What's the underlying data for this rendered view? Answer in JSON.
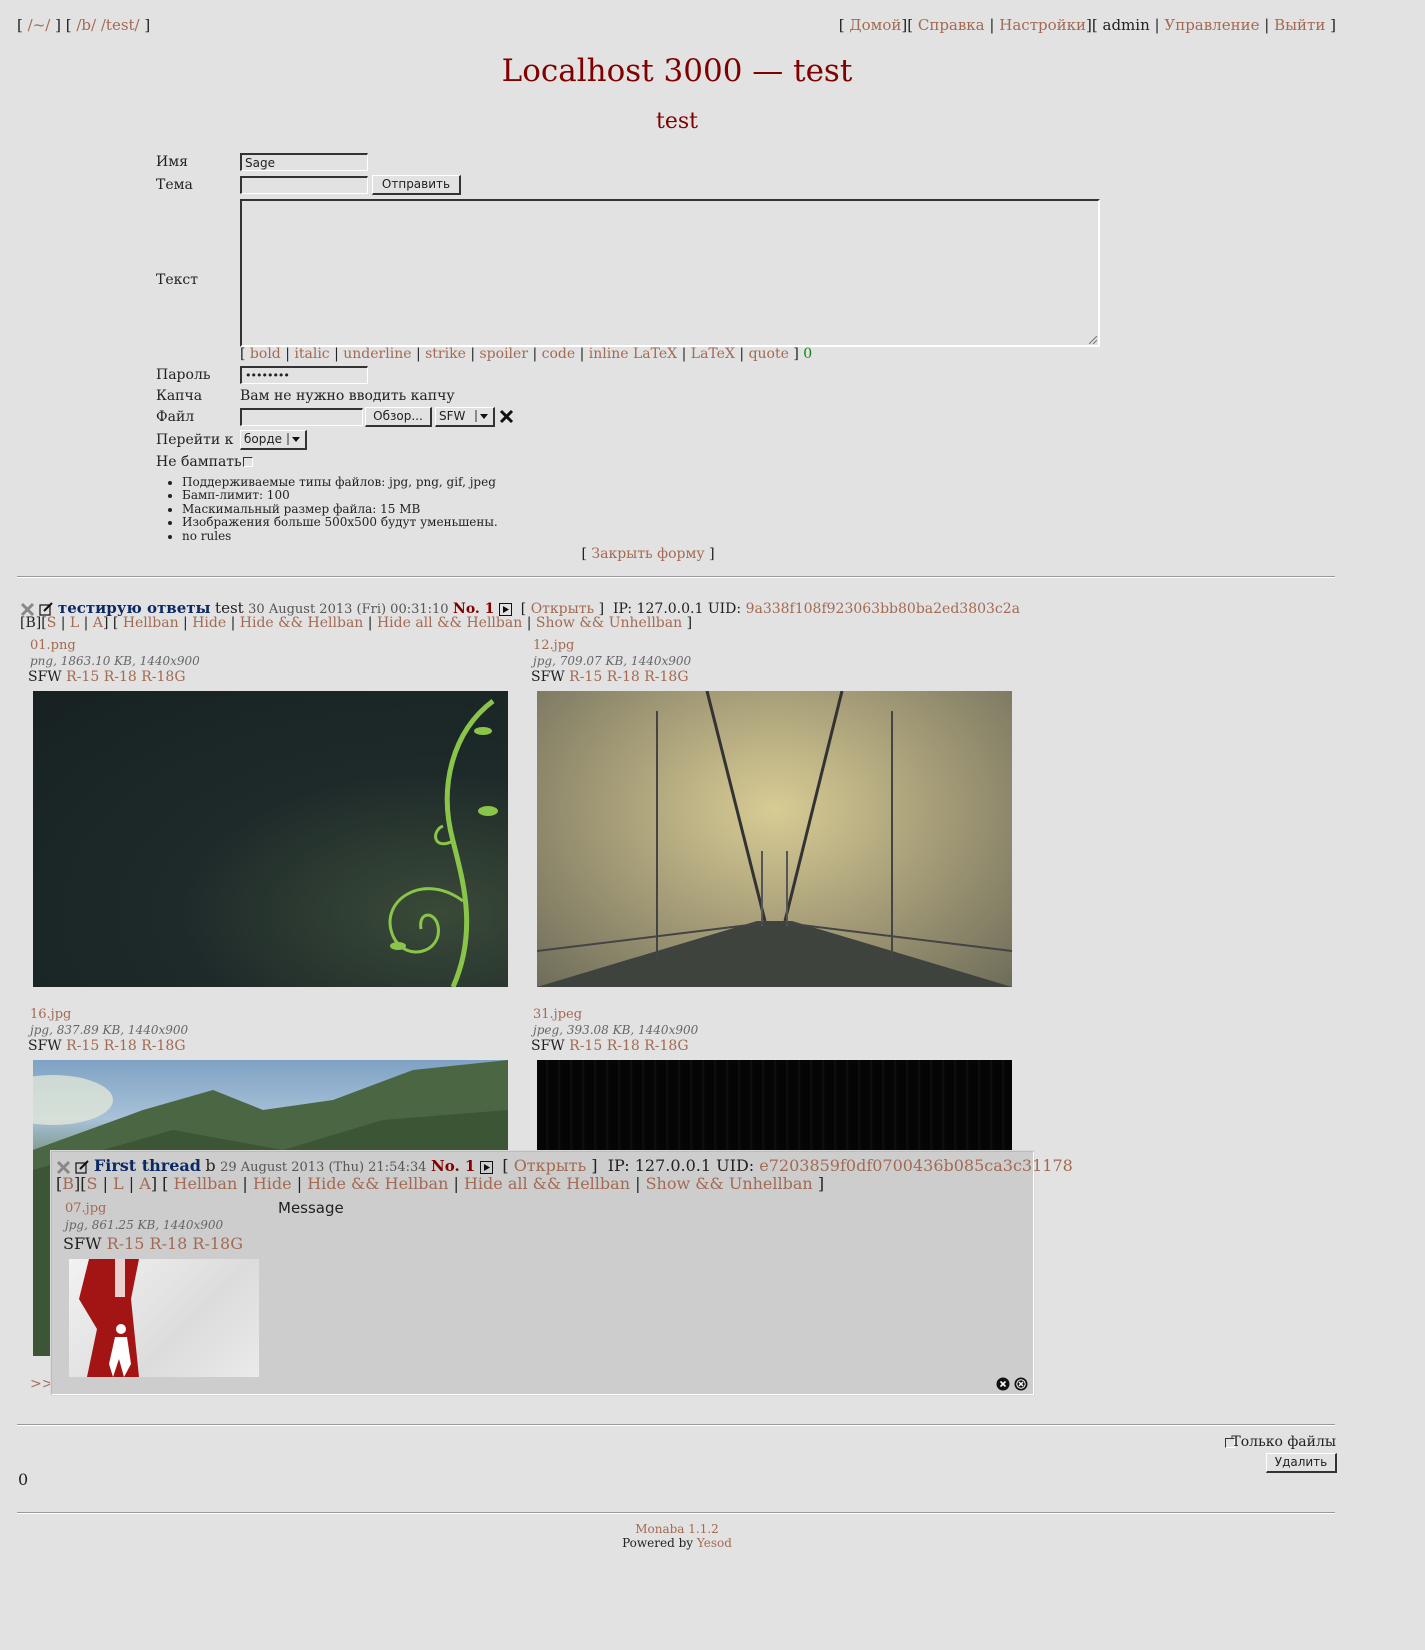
{
  "topnav": {
    "left": {
      "b1": "[",
      "root": "/~/",
      "b2": "] [",
      "b": "/b/",
      "test": "/test/",
      "b3": "]"
    },
    "right": {
      "b1": "[",
      "home": "Домой",
      "b2": "][",
      "help": "Справка",
      "sep1": "|",
      "settings": "Настройки",
      "b3": "][",
      "user": "admin",
      "sep2": "|",
      "manage": "Управление",
      "sep3": "|",
      "logout": "Выйти",
      "b4": "]"
    }
  },
  "board": {
    "title": "Localhost 3000 — test",
    "subtitle": "test"
  },
  "form": {
    "name_label": "Имя",
    "name_value": "Sage",
    "subject_label": "Тема",
    "subject_value": "",
    "submit_label": "Отправить",
    "text_label": "Текст",
    "markup": {
      "open": "[",
      "bold": "bold",
      "italic": "italic",
      "underline": "underline",
      "strike": "strike",
      "spoiler": "spoiler",
      "code": "code",
      "inline_latex": "inline LaTeX",
      "latex": "LaTeX",
      "quote": "quote",
      "close": "]",
      "sep": "|",
      "counter": "0"
    },
    "password_label": "Пароль",
    "password_value": "••••••••",
    "captcha_label": "Капча",
    "captcha_text": "Вам не нужно вводить капчу",
    "file_label": "Файл",
    "browse_label": "Обзор...",
    "rating_value": "SFW",
    "goto_label": "Перейти к",
    "goto_value": "борде",
    "nobump_label": "Не бампать",
    "rules": [
      "Поддерживаемые типы файлов: jpg, png, gif, jpeg",
      "Бамп-лимит: 100",
      "Маскимальный размер файла: 15 MB",
      "Изображения больше 500x500 будут уменьшены.",
      "no rules"
    ],
    "close_form": {
      "open": "[",
      "label": "Закрыть форму",
      "close": "]"
    }
  },
  "thread": {
    "subject": "тестирую ответы",
    "name": "test",
    "date": "30 August 2013 (Fri) 00:31:10",
    "number": "No. 1",
    "open": {
      "b1": "[",
      "label": "Открыть",
      "b2": "]"
    },
    "ip": "IP: 127.0.0.1 UID:",
    "uid": "9a338f108f923063bb80ba2ed3803c2a",
    "actions": {
      "b_open": "[",
      "B": "B",
      "b_mid": "][",
      "S": "S",
      "sep": "|",
      "L": "L",
      "A": "A",
      "b_close": "]",
      "hellban": "Hellban",
      "hide": "Hide",
      "hide_hellban": "Hide && Hellban",
      "hide_all_hellban": "Hide all && Hellban",
      "show_unhellban": "Show && Unhellban"
    },
    "files": [
      {
        "name": "01.png",
        "info": "png, 1863.10 KB, 1440x900"
      },
      {
        "name": "12.jpg",
        "info": "jpg, 709.07 KB, 1440x900"
      },
      {
        "name": "16.jpg",
        "info": "jpg, 837.89 KB, 1440x900"
      },
      {
        "name": "31.jpeg",
        "info": "jpeg, 393.08 KB, 1440x900"
      }
    ],
    "ratings": {
      "sfw": "SFW",
      "r15": "R-15",
      "r18": "R-18",
      "r18g": "R-18G"
    },
    "reply_link": ">>"
  },
  "popup": {
    "subject": "First thread",
    "name": "b",
    "date": "29 August 2013 (Thu) 21:54:34",
    "number": "No. 1",
    "ip": "IP: 127.0.0.1 UID:",
    "uid": "e7203859f0df0700436b085ca3c31178",
    "file": {
      "name": "07.jpg",
      "info": "jpg, 861.25 KB, 1440x900"
    },
    "message": "Message"
  },
  "bottom": {
    "only_files_label": "Только файлы",
    "delete_label": "Удалить",
    "page": "0"
  },
  "footer": {
    "engine": "Monaba 1.1.2",
    "powered": "Powered by",
    "yesod": "Yesod"
  },
  "colors": {
    "link": "#a36a53",
    "title": "#800000",
    "subject": "#0b2a63",
    "background": "#e2e2e2"
  }
}
